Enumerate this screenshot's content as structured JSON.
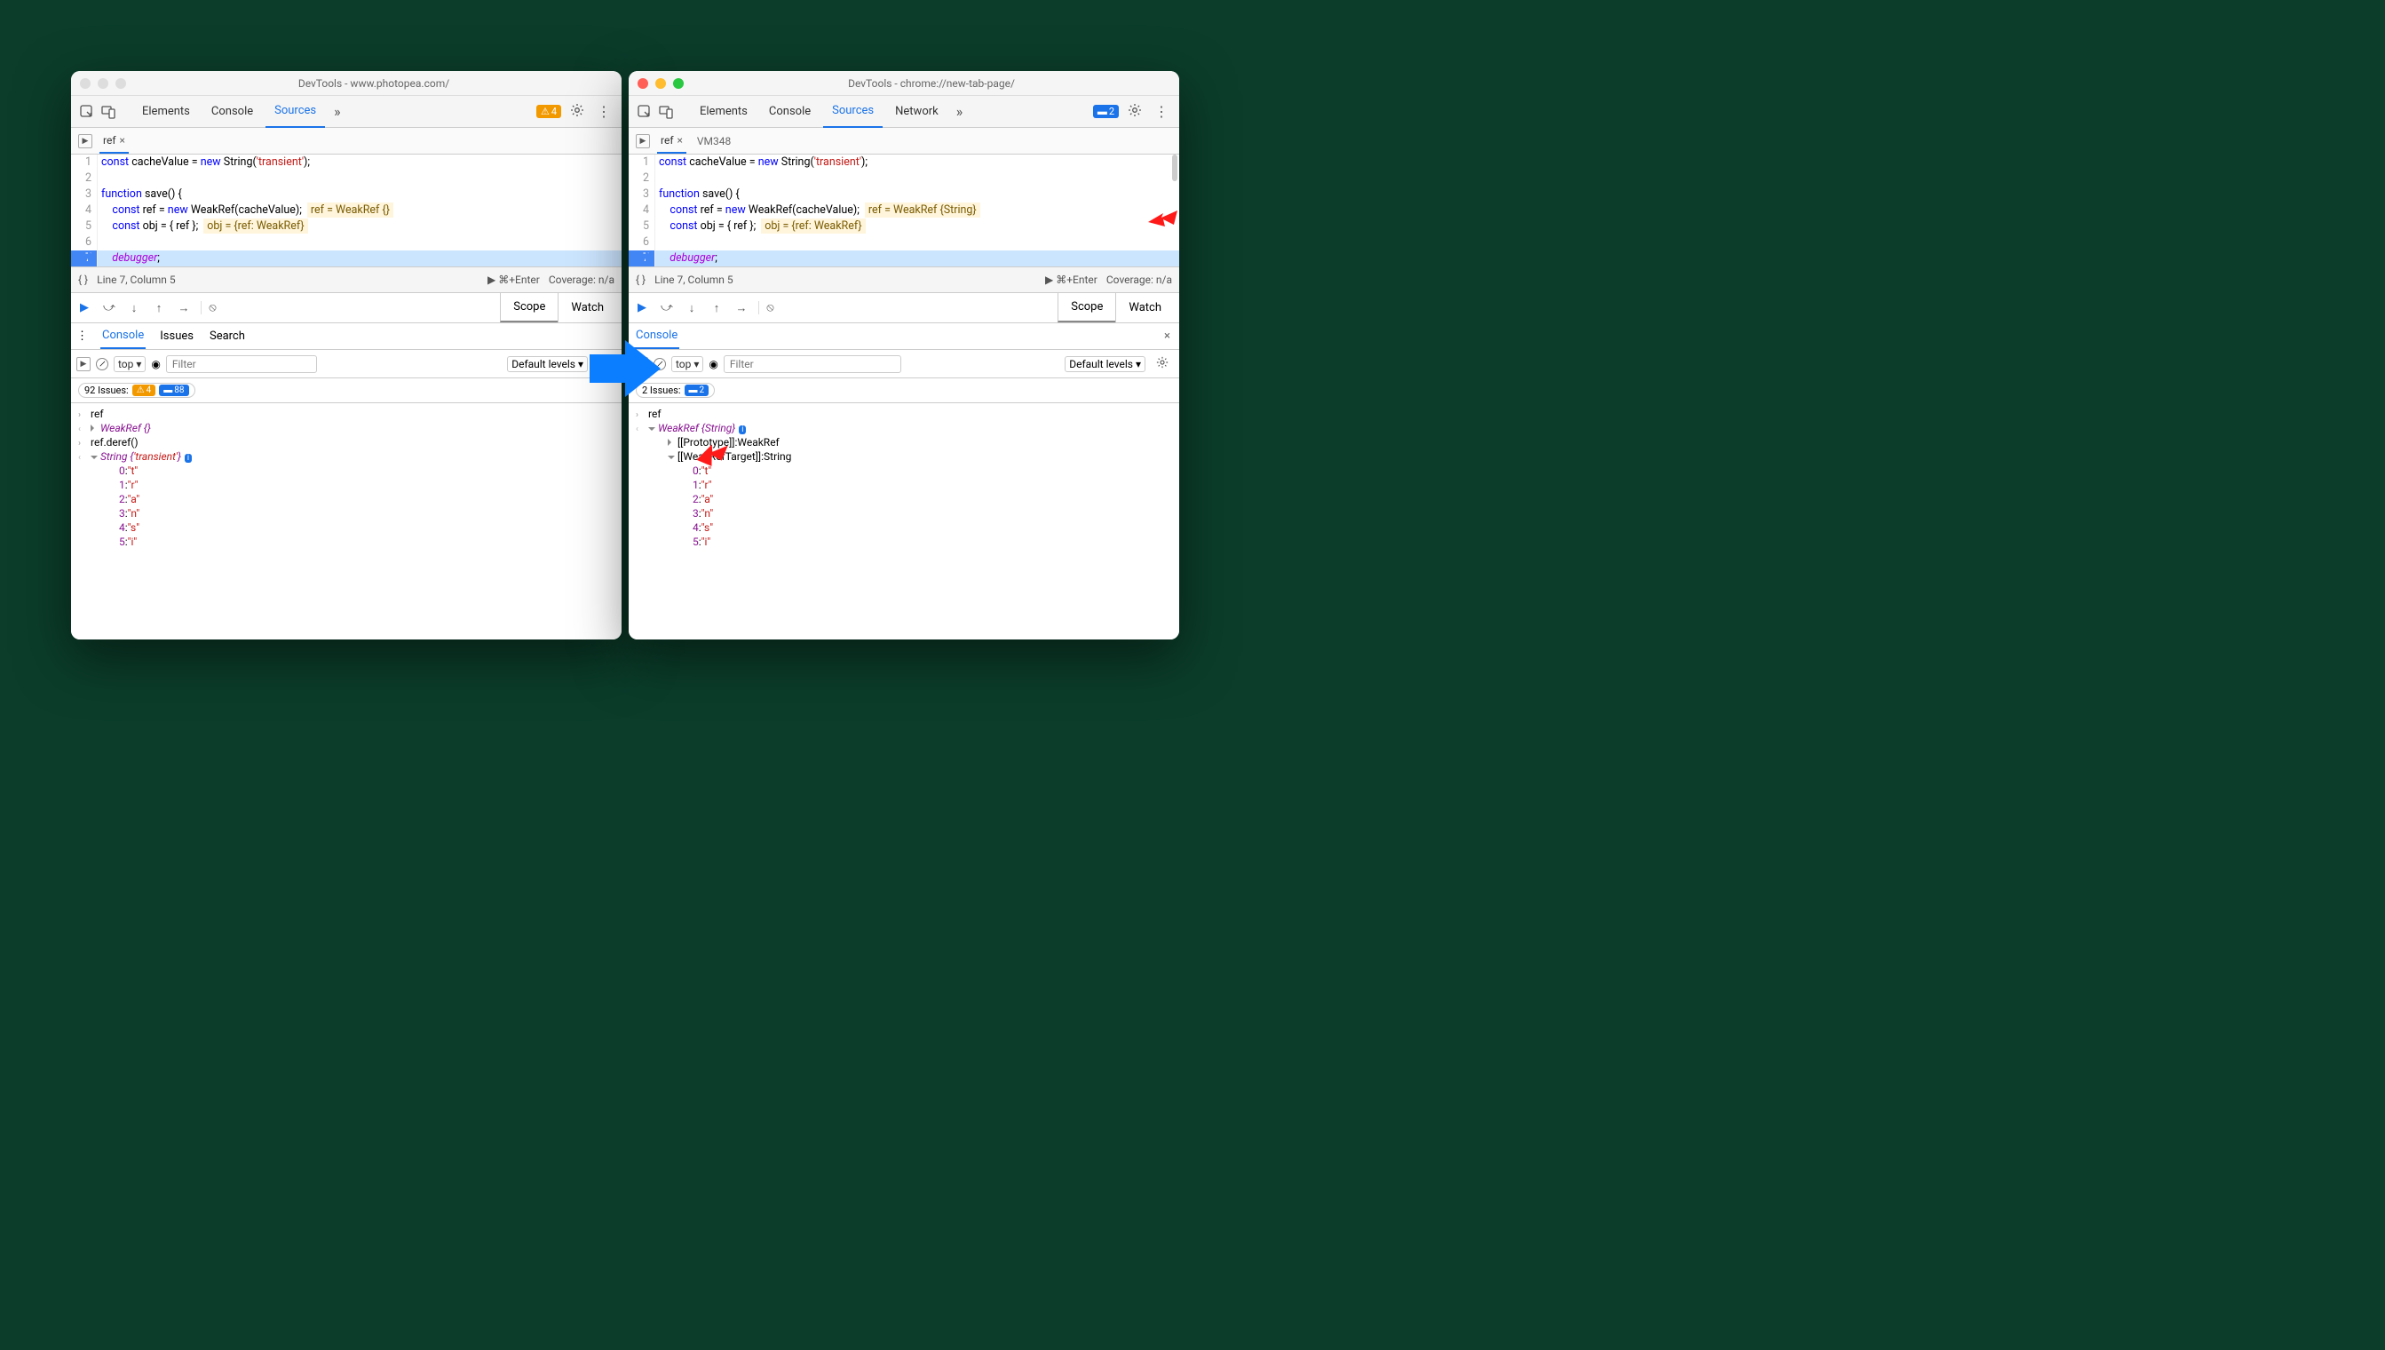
{
  "left": {
    "title": "DevTools - www.photopea.com/",
    "tabs": [
      "Elements",
      "Console",
      "Sources"
    ],
    "activeTab": "Sources",
    "warnBadge": "4",
    "subtab": "ref",
    "code": {
      "l1_a": "const",
      "l1_b": " cacheValue = ",
      "l1_c": "new",
      "l1_d": " String(",
      "l1_e": "'transient'",
      "l1_f": ");",
      "l3_a": "function",
      "l3_b": " save() {",
      "l4_a": "    const",
      "l4_b": " ref = ",
      "l4_c": "new",
      "l4_d": " WeakRef(cacheValue);",
      "l4_eval": "ref = WeakRef {}",
      "l5_a": "    const",
      "l5_b": " obj = { ref };",
      "l5_eval": "obj = {ref: WeakRef}",
      "l7_a": "    debugger",
      "l7_b": ";"
    },
    "cursor": "Line 7, Column 5",
    "coverage": "Coverage: n/a",
    "run_shortcut": "⌘+Enter",
    "scopeTabs": [
      "Scope",
      "Watch"
    ],
    "drawerTabs": [
      "Console",
      "Issues",
      "Search"
    ],
    "consoleCtx": "top ▾",
    "consoleLevels": "Default levels ▾",
    "issuesLabel": "92 Issues:",
    "issuesWarn": "4",
    "issuesInfo": "88",
    "log": {
      "r1": "ref",
      "r2": "WeakRef {}",
      "r3": "ref.deref()",
      "r4_pre": "String {",
      "r4_str": "'transient'",
      "r4_post": "}",
      "chars": [
        {
          "k": "0",
          "v": "\"t\""
        },
        {
          "k": "1",
          "v": "\"r\""
        },
        {
          "k": "2",
          "v": "\"a\""
        },
        {
          "k": "3",
          "v": "\"n\""
        },
        {
          "k": "4",
          "v": "\"s\""
        },
        {
          "k": "5",
          "v": "\"i\""
        }
      ]
    }
  },
  "right": {
    "title": "DevTools - chrome://new-tab-page/",
    "tabs": [
      "Elements",
      "Console",
      "Sources",
      "Network"
    ],
    "activeTab": "Sources",
    "infoBadge": "2",
    "subtab": "ref",
    "vmtab": "VM348",
    "code": {
      "l4_eval": "ref = WeakRef {String}",
      "l5_eval": "obj = {ref: WeakRef}"
    },
    "cursor": "Line 7, Column 5",
    "coverage": "Coverage: n/a",
    "run_shortcut": "⌘+Enter",
    "scopeTabs": [
      "Scope",
      "Watch"
    ],
    "drawerTabs": [
      "Console"
    ],
    "consoleCtx": "top ▾",
    "consoleLevels": "Default levels ▾",
    "issuesLabel": "2 Issues:",
    "issuesInfo": "2",
    "log": {
      "r1": "ref",
      "r2_pre": "WeakRef ",
      "r2_mid": "{String}",
      "proto": "[[Prototype]]: ",
      "proto_v": "WeakRef",
      "wrt": "[[WeakRefTarget]]: ",
      "wrt_v": "String",
      "chars": [
        {
          "k": "0",
          "v": "\"t\""
        },
        {
          "k": "1",
          "v": "\"r\""
        },
        {
          "k": "2",
          "v": "\"a\""
        },
        {
          "k": "3",
          "v": "\"n\""
        },
        {
          "k": "4",
          "v": "\"s\""
        },
        {
          "k": "5",
          "v": "\"i\""
        }
      ]
    }
  },
  "filterPlaceholder": "Filter"
}
